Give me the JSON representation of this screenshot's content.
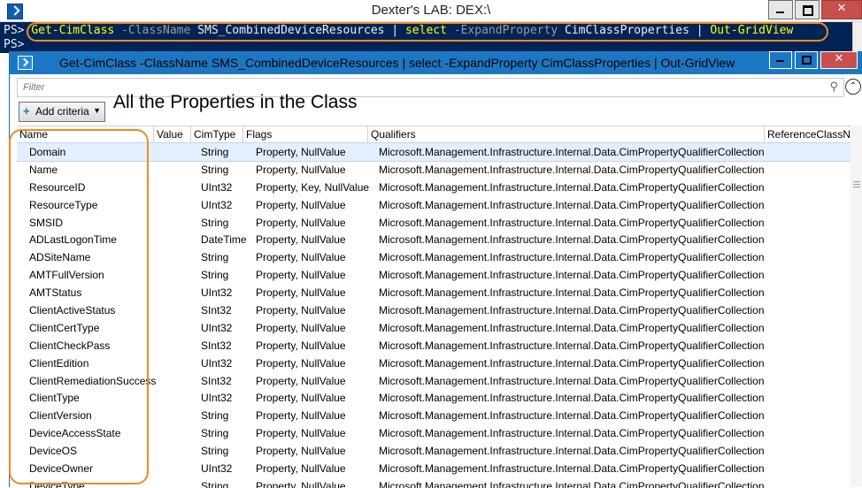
{
  "outer_window": {
    "title": "Dexter's LAB: DEX:\\"
  },
  "console": {
    "prompt1": "PS>",
    "prompt2": "PS>",
    "command": {
      "cmd1": "Get-CimClass",
      "param1": "-ClassName",
      "arg1": "SMS_CombinedDeviceResources",
      "pipe1": "|",
      "cmd2": "select",
      "param2": "-ExpandProperty",
      "arg2": "CimClassProperties",
      "pipe2": "|",
      "cmd3": "Out-GridView"
    }
  },
  "gridview": {
    "title": "Get-CimClass -ClassName SMS_CombinedDeviceResources | select -ExpandProperty CimClassProperties | Out-GridView",
    "filter_placeholder": "Filter",
    "add_criteria_label": "Add criteria",
    "annotation": "All the Properties in the Class",
    "columns": [
      "Name",
      "Value",
      "CimType",
      "Flags",
      "Qualifiers",
      "ReferenceClassN"
    ],
    "rows": [
      {
        "name": "Domain",
        "value": "",
        "cimtype": "String",
        "flags": "Property, NullValue",
        "qualifiers": "Microsoft.Management.Infrastructure.Internal.Data.CimPropertyQualifierCollection"
      },
      {
        "name": "Name",
        "value": "",
        "cimtype": "String",
        "flags": "Property, NullValue",
        "qualifiers": "Microsoft.Management.Infrastructure.Internal.Data.CimPropertyQualifierCollection"
      },
      {
        "name": "ResourceID",
        "value": "",
        "cimtype": "UInt32",
        "flags": "Property, Key, NullValue",
        "qualifiers": "Microsoft.Management.Infrastructure.Internal.Data.CimPropertyQualifierCollection"
      },
      {
        "name": "ResourceType",
        "value": "",
        "cimtype": "UInt32",
        "flags": "Property, NullValue",
        "qualifiers": "Microsoft.Management.Infrastructure.Internal.Data.CimPropertyQualifierCollection"
      },
      {
        "name": "SMSID",
        "value": "",
        "cimtype": "String",
        "flags": "Property, NullValue",
        "qualifiers": "Microsoft.Management.Infrastructure.Internal.Data.CimPropertyQualifierCollection"
      },
      {
        "name": "ADLastLogonTime",
        "value": "",
        "cimtype": "DateTime",
        "flags": "Property, NullValue",
        "qualifiers": "Microsoft.Management.Infrastructure.Internal.Data.CimPropertyQualifierCollection"
      },
      {
        "name": "ADSiteName",
        "value": "",
        "cimtype": "String",
        "flags": "Property, NullValue",
        "qualifiers": "Microsoft.Management.Infrastructure.Internal.Data.CimPropertyQualifierCollection"
      },
      {
        "name": "AMTFullVersion",
        "value": "",
        "cimtype": "String",
        "flags": "Property, NullValue",
        "qualifiers": "Microsoft.Management.Infrastructure.Internal.Data.CimPropertyQualifierCollection"
      },
      {
        "name": "AMTStatus",
        "value": "",
        "cimtype": "UInt32",
        "flags": "Property, NullValue",
        "qualifiers": "Microsoft.Management.Infrastructure.Internal.Data.CimPropertyQualifierCollection"
      },
      {
        "name": "ClientActiveStatus",
        "value": "",
        "cimtype": "SInt32",
        "flags": "Property, NullValue",
        "qualifiers": "Microsoft.Management.Infrastructure.Internal.Data.CimPropertyQualifierCollection"
      },
      {
        "name": "ClientCertType",
        "value": "",
        "cimtype": "UInt32",
        "flags": "Property, NullValue",
        "qualifiers": "Microsoft.Management.Infrastructure.Internal.Data.CimPropertyQualifierCollection"
      },
      {
        "name": "ClientCheckPass",
        "value": "",
        "cimtype": "SInt32",
        "flags": "Property, NullValue",
        "qualifiers": "Microsoft.Management.Infrastructure.Internal.Data.CimPropertyQualifierCollection"
      },
      {
        "name": "ClientEdition",
        "value": "",
        "cimtype": "UInt32",
        "flags": "Property, NullValue",
        "qualifiers": "Microsoft.Management.Infrastructure.Internal.Data.CimPropertyQualifierCollection"
      },
      {
        "name": "ClientRemediationSuccess",
        "value": "",
        "cimtype": "SInt32",
        "flags": "Property, NullValue",
        "qualifiers": "Microsoft.Management.Infrastructure.Internal.Data.CimPropertyQualifierCollection"
      },
      {
        "name": "ClientType",
        "value": "",
        "cimtype": "UInt32",
        "flags": "Property, NullValue",
        "qualifiers": "Microsoft.Management.Infrastructure.Internal.Data.CimPropertyQualifierCollection"
      },
      {
        "name": "ClientVersion",
        "value": "",
        "cimtype": "String",
        "flags": "Property, NullValue",
        "qualifiers": "Microsoft.Management.Infrastructure.Internal.Data.CimPropertyQualifierCollection"
      },
      {
        "name": "DeviceAccessState",
        "value": "",
        "cimtype": "String",
        "flags": "Property, NullValue",
        "qualifiers": "Microsoft.Management.Infrastructure.Internal.Data.CimPropertyQualifierCollection"
      },
      {
        "name": "DeviceOS",
        "value": "",
        "cimtype": "String",
        "flags": "Property, NullValue",
        "qualifiers": "Microsoft.Management.Infrastructure.Internal.Data.CimPropertyQualifierCollection"
      },
      {
        "name": "DeviceOwner",
        "value": "",
        "cimtype": "UInt32",
        "flags": "Property, NullValue",
        "qualifiers": "Microsoft.Management.Infrastructure.Internal.Data.CimPropertyQualifierCollection"
      },
      {
        "name": "DeviceType",
        "value": "",
        "cimtype": "String",
        "flags": "Property, NullValue",
        "qualifiers": "Microsoft.Management.Infrastructure.Internal.Data.CimPropertyQualifierCollection"
      }
    ]
  },
  "colors": {
    "console_bg": "#012456",
    "cmdlet": "#ffff00",
    "parameter": "#9a9a9a",
    "highlight_ring": "#f08a24",
    "gridview_titlebar": "#1c77c3",
    "selected_row": "#e3efff"
  }
}
